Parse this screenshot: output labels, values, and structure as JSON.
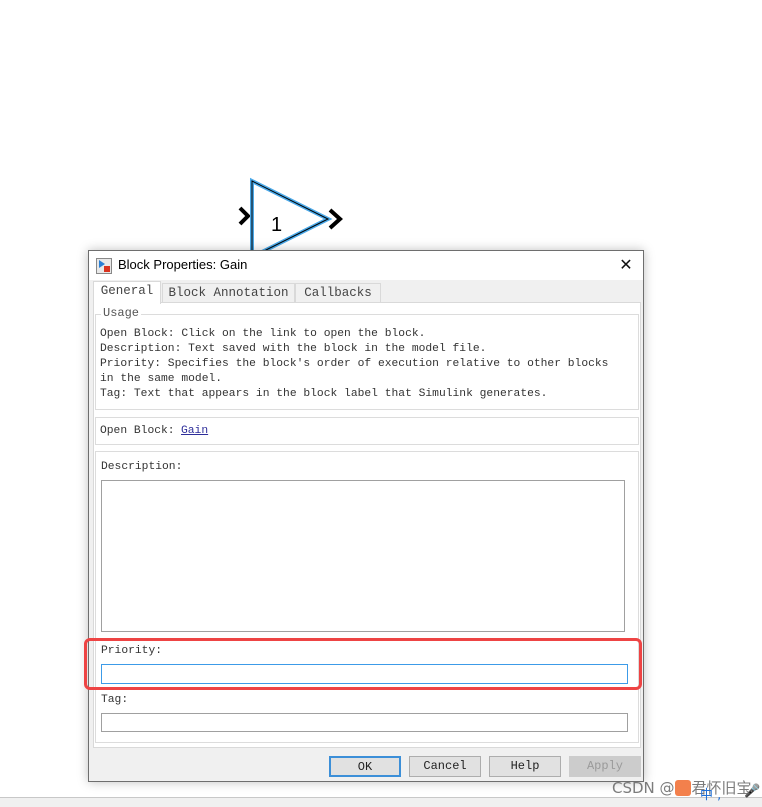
{
  "canvas": {
    "block": {
      "name": "Gain",
      "value": "1",
      "selection_color": "#4aa8e8"
    }
  },
  "dialog": {
    "title": "Block Properties: Gain",
    "close_icon": "close-icon",
    "tabs": [
      {
        "label": "General",
        "active": true
      },
      {
        "label": "Block Annotation",
        "active": false
      },
      {
        "label": "Callbacks",
        "active": false
      }
    ],
    "usage": {
      "legend": "Usage",
      "lines": [
        "Open Block: Click on the link to open the block.",
        "Description: Text saved with the block in the model file.",
        "Priority: Specifies the block's order of execution relative to other blocks",
        "in the same model.",
        "Tag: Text that appears in the block label that Simulink generates."
      ]
    },
    "open_block": {
      "label": "Open Block:",
      "link": "Gain"
    },
    "description": {
      "label": "Description:",
      "value": ""
    },
    "priority": {
      "label": "Priority:",
      "value": "",
      "highlight_color": "#ee4444"
    },
    "tag": {
      "label": "Tag:",
      "value": ""
    },
    "buttons": {
      "ok": "OK",
      "cancel": "Cancel",
      "help": "Help",
      "apply": "Apply"
    }
  },
  "watermark": "CSDN @君怀旧宝"
}
